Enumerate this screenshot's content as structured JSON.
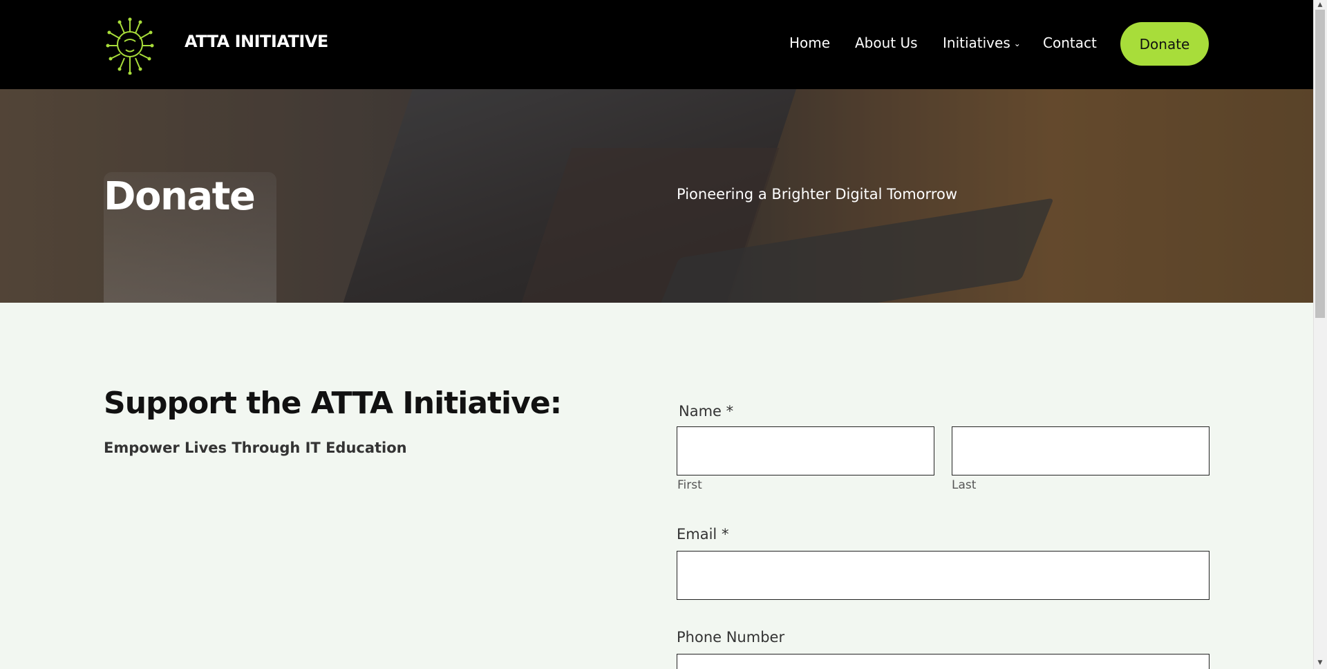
{
  "header": {
    "brand": "ATTA INITIATIVE",
    "logo_icon": "lion-circuit-logo-icon",
    "nav": [
      {
        "label": "Home"
      },
      {
        "label": "About Us"
      },
      {
        "label": "Initiatives",
        "has_dropdown": true
      },
      {
        "label": "Contact"
      }
    ],
    "donate_label": "Donate"
  },
  "hero": {
    "title": "Donate",
    "subtitle": "Pioneering a Brighter Digital Tomorrow"
  },
  "support": {
    "title": "Support the ATTA Initiative:",
    "subtitle": "Empower Lives Through IT Education"
  },
  "form": {
    "name_label": "Name *",
    "first_label": "First",
    "last_label": "Last",
    "email_label": "Email *",
    "phone_label": "Phone Number"
  },
  "colors": {
    "header_bg": "#000000",
    "accent": "#a8dd3a",
    "page_bg": "#f2f7f1"
  }
}
